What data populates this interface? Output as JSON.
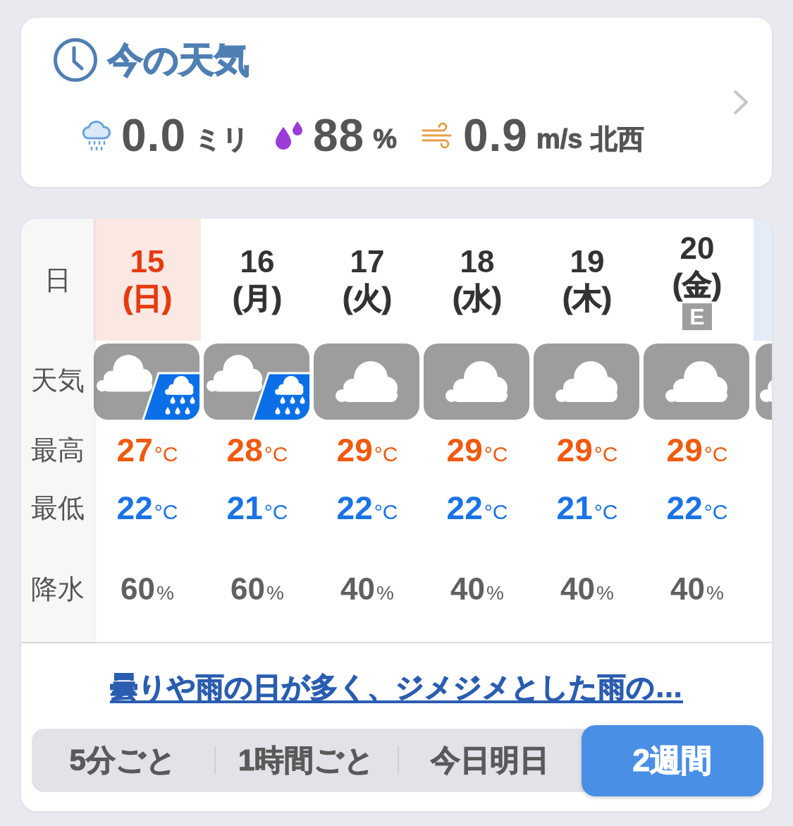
{
  "current_weather": {
    "title": "今の天気",
    "readings": [
      {
        "kind": "rain",
        "value": "0.0",
        "unit": "ミリ"
      },
      {
        "kind": "humidity",
        "value": "88",
        "unit": "%"
      },
      {
        "kind": "wind",
        "value": "0.9",
        "unit": "m/s",
        "direction": "北西"
      }
    ]
  },
  "forecast": {
    "row_labels": [
      "日",
      "天気",
      "最高",
      "最低",
      "降水"
    ],
    "days": [
      {
        "kind": "sunday",
        "date": "15",
        "weekday": "(日)",
        "weather": {
          "kind": "cloudy_rain"
        },
        "high": "27",
        "high_unit": "°C",
        "low": "22",
        "low_unit": "°C",
        "precip": "60",
        "precip_unit": "%"
      },
      {
        "kind": "weekday",
        "date": "16",
        "weekday": "(月)",
        "weather": {
          "kind": "cloudy_rain"
        },
        "high": "28",
        "high_unit": "°C",
        "low": "21",
        "low_unit": "°C",
        "precip": "60",
        "precip_unit": "%"
      },
      {
        "kind": "weekday",
        "date": "17",
        "weekday": "(火)",
        "weather": {
          "kind": "cloudy"
        },
        "high": "29",
        "high_unit": "°C",
        "low": "22",
        "low_unit": "°C",
        "precip": "40",
        "precip_unit": "%"
      },
      {
        "kind": "weekday",
        "date": "18",
        "weekday": "(水)",
        "weather": {
          "kind": "cloudy"
        },
        "high": "29",
        "high_unit": "°C",
        "low": "22",
        "low_unit": "°C",
        "precip": "40",
        "precip_unit": "%"
      },
      {
        "kind": "weekday",
        "date": "19",
        "weekday": "(木)",
        "weather": {
          "kind": "cloudy"
        },
        "high": "29",
        "high_unit": "°C",
        "low": "21",
        "low_unit": "°C",
        "precip": "40",
        "precip_unit": "%"
      },
      {
        "kind": "weekday",
        "date": "20",
        "weekday": "(金)",
        "badge": "E",
        "weather": {
          "kind": "cloudy"
        },
        "high": "29",
        "high_unit": "°C",
        "low": "22",
        "low_unit": "°C",
        "precip": "40",
        "precip_unit": "%"
      },
      {
        "kind": "saturday",
        "weather": {
          "kind": "cloudy"
        }
      }
    ],
    "summary_link": "曇りや雨の日が多く、ジメジメとした雨の…"
  },
  "view_tabs": [
    {
      "label": "5分ごと",
      "selected": false
    },
    {
      "label": "1時間ごと",
      "selected": false
    },
    {
      "label": "今日明日",
      "selected": false
    },
    {
      "label": "2週間",
      "selected": true
    }
  ]
}
